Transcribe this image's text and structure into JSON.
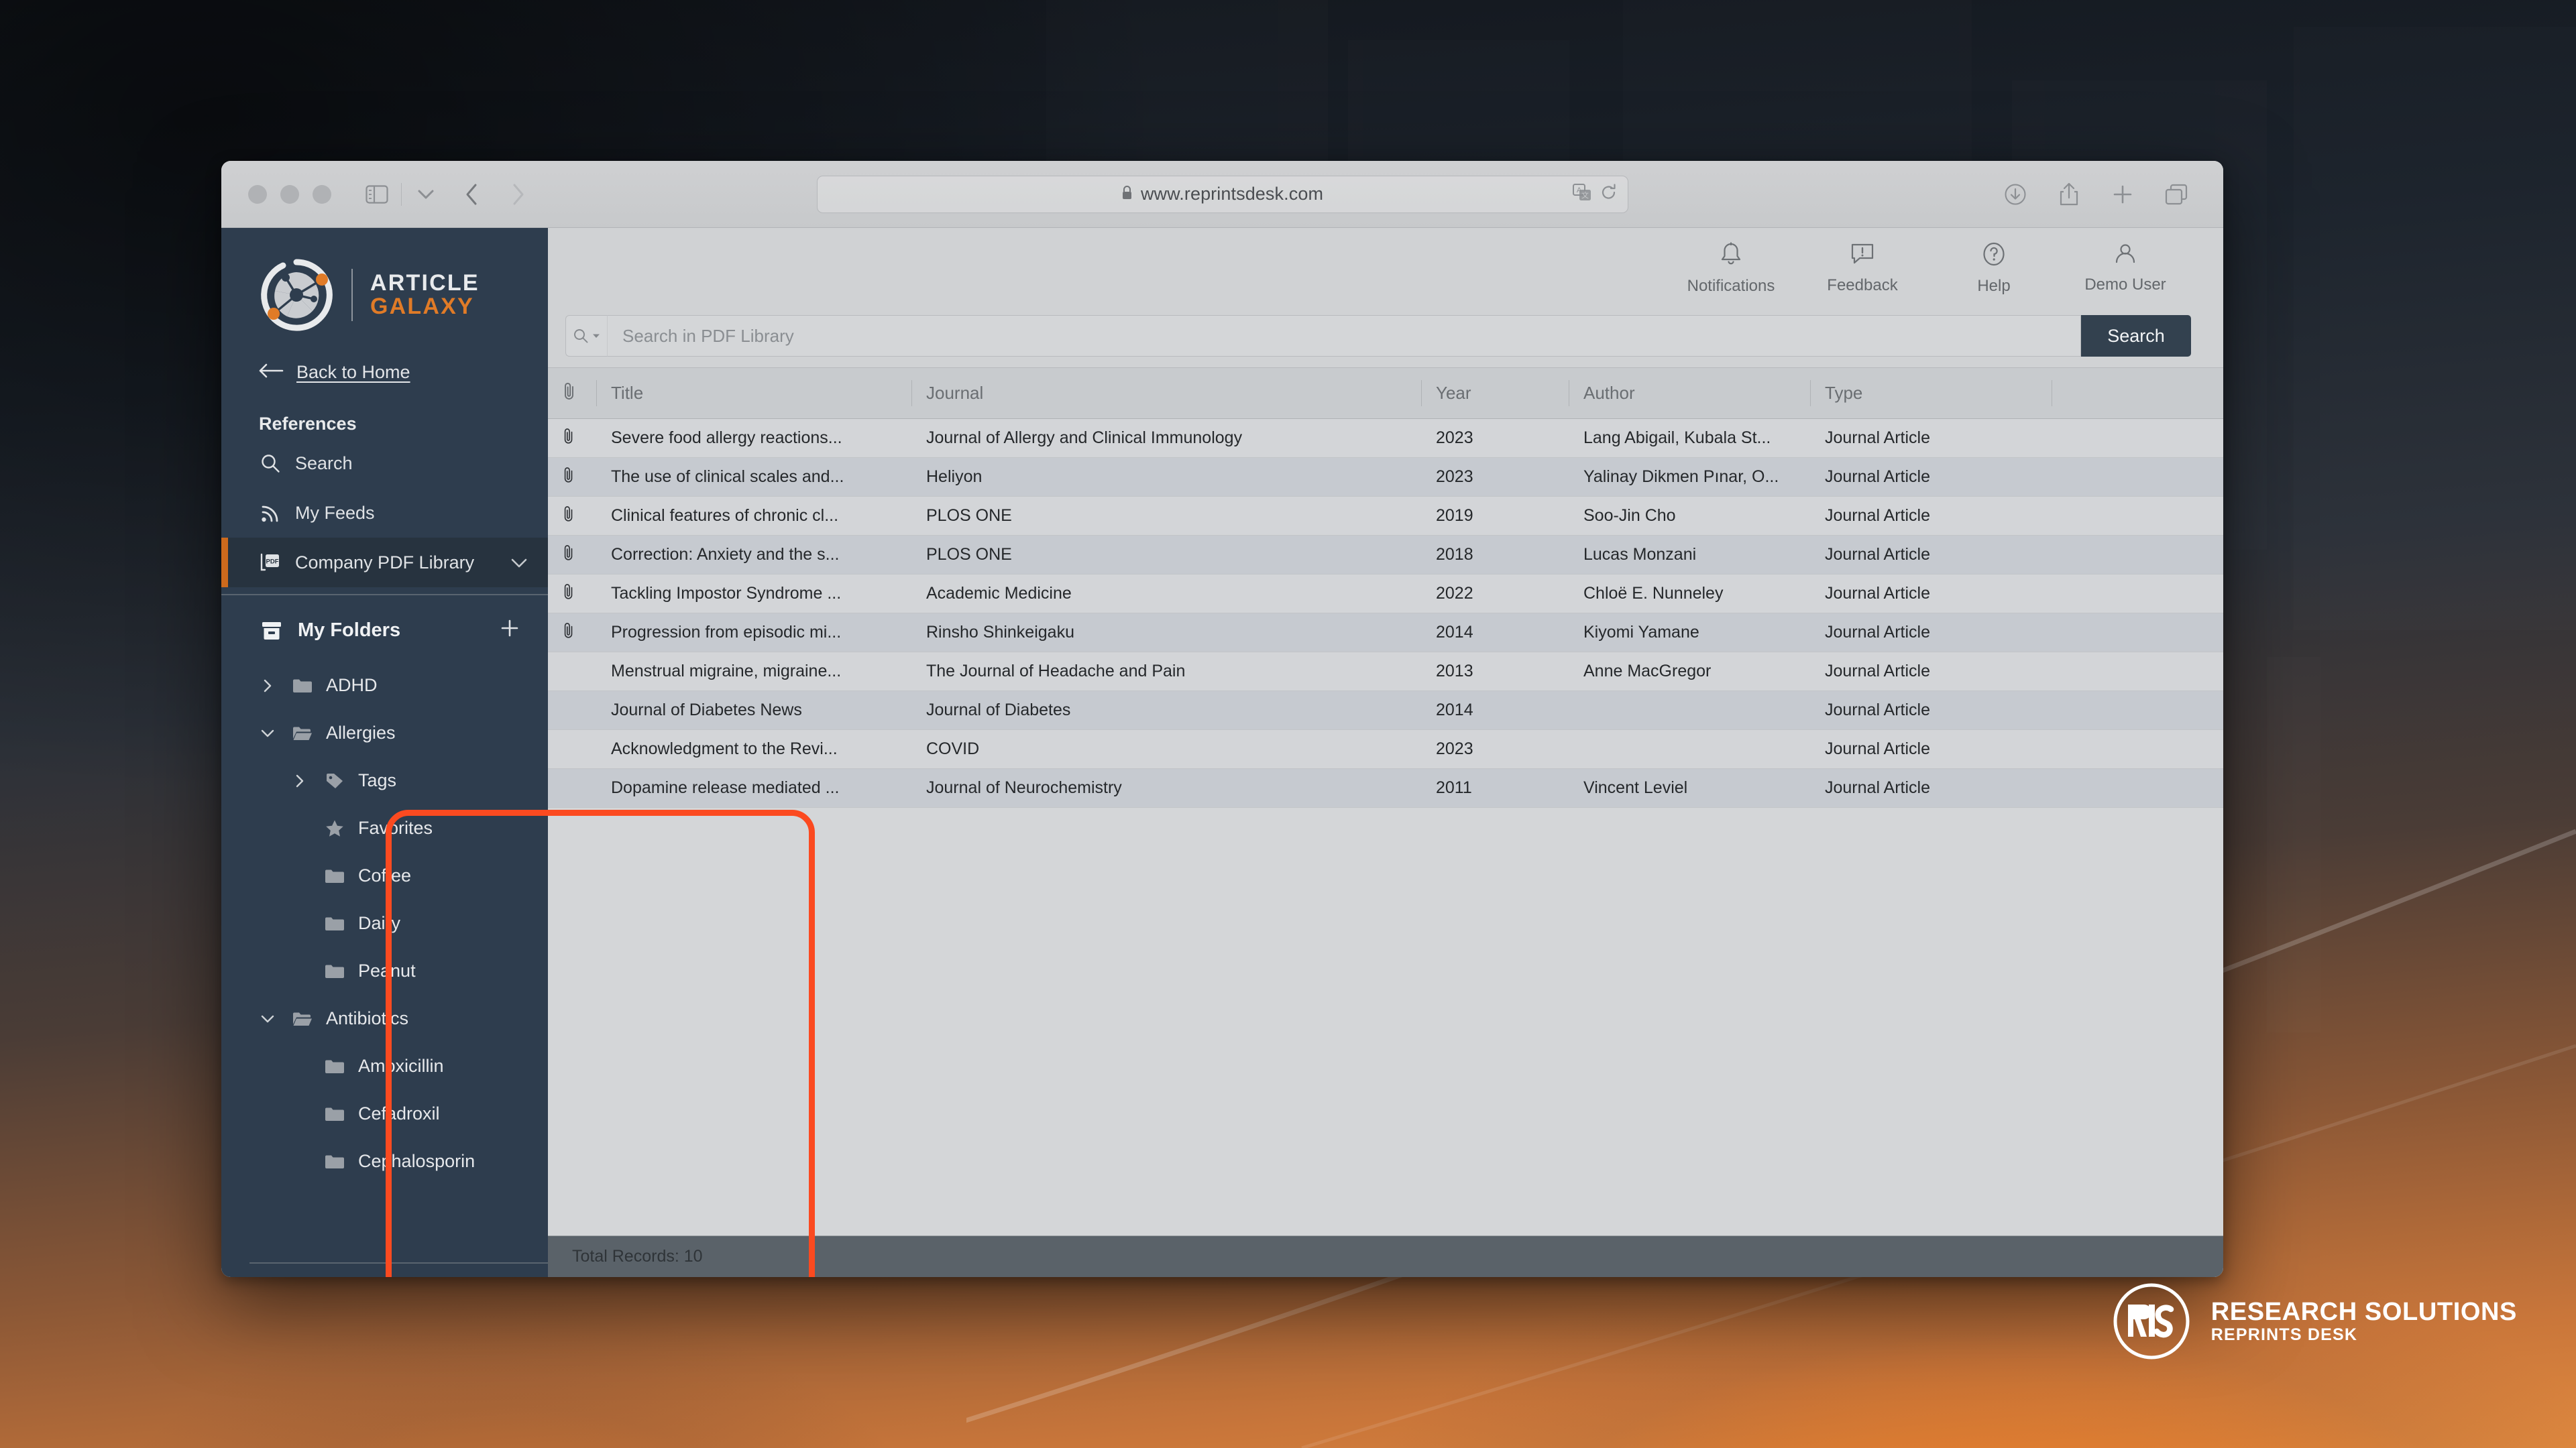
{
  "browser": {
    "url": "www.reprintsdesk.com",
    "lock_icon": "lock-icon",
    "traffic_lights": [
      "close",
      "minimize",
      "maximize"
    ],
    "toolbar_icons": [
      "sidebar-toggle-icon",
      "chevron-down-icon",
      "back-arrow-icon",
      "forward-arrow-icon"
    ],
    "url_right_icons": [
      "translate-icon",
      "reload-icon"
    ],
    "right_icons": [
      "downloads-icon",
      "share-icon",
      "new-tab-icon",
      "tab-overview-icon"
    ]
  },
  "logo": {
    "line1": "ARTICLE",
    "line2": "GALAXY",
    "mark": "article-galaxy-logo"
  },
  "sidebar": {
    "back_home": "Back to Home",
    "back_icon": "arrow-left-icon",
    "section_title": "References",
    "nav": [
      {
        "label": "Search",
        "icon": "search-icon",
        "active": false,
        "chevron": ""
      },
      {
        "label": "My Feeds",
        "icon": "rss-icon",
        "active": false,
        "chevron": ""
      },
      {
        "label": "Company PDF Library",
        "icon": "pdf-icon",
        "active": true,
        "chevron": "chevron-down-icon"
      }
    ],
    "folders": {
      "title": "My Folders",
      "title_icon": "archive-box-icon",
      "add_icon": "plus-icon",
      "tree": [
        {
          "label": "ADHD",
          "icon": "folder-icon",
          "caret": "chevron-right-icon",
          "level": 0
        },
        {
          "label": "Allergies",
          "icon": "folder-open-icon",
          "caret": "chevron-down-icon",
          "level": 0
        },
        {
          "label": "Tags",
          "icon": "tag-icon",
          "caret": "chevron-right-icon",
          "level": 1
        },
        {
          "label": "Favorites",
          "icon": "star-icon",
          "caret": "",
          "level": 1
        },
        {
          "label": "Coffee",
          "icon": "folder-icon",
          "caret": "",
          "level": 1
        },
        {
          "label": "Dairy",
          "icon": "folder-icon",
          "caret": "",
          "level": 1
        },
        {
          "label": "Peanut",
          "icon": "folder-icon",
          "caret": "",
          "level": 1
        },
        {
          "label": "Antibiotics",
          "icon": "folder-open-icon",
          "caret": "chevron-down-icon",
          "level": 0
        },
        {
          "label": "Amoxicillin",
          "icon": "folder-icon",
          "caret": "",
          "level": 1
        },
        {
          "label": "Cefadroxil",
          "icon": "folder-icon",
          "caret": "",
          "level": 1
        },
        {
          "label": "Cephalosporin",
          "icon": "folder-icon",
          "caret": "",
          "level": 1
        }
      ]
    }
  },
  "topbar": {
    "actions": [
      {
        "label": "Notifications",
        "icon": "bell-icon"
      },
      {
        "label": "Feedback",
        "icon": "feedback-chat-icon"
      },
      {
        "label": "Help",
        "icon": "question-circle-icon"
      },
      {
        "label": "Demo User",
        "icon": "user-icon"
      }
    ]
  },
  "search": {
    "placeholder": "Search in PDF Library",
    "value": "",
    "mode_icon": "search-icon",
    "mode_caret": "caret-down-icon",
    "button_label": "Search"
  },
  "table": {
    "columns": [
      "",
      "Title",
      "Journal",
      "Year",
      "Author",
      "Type",
      ""
    ],
    "clip_icon": "paperclip-icon",
    "rows": [
      {
        "clip": true,
        "title": "Severe food allergy reactions...",
        "journal": "Journal of Allergy and Clinical Immunology",
        "year": "2023",
        "author": "Lang Abigail, Kubala St...",
        "type": "Journal Article"
      },
      {
        "clip": true,
        "title": "The use of clinical scales and...",
        "journal": "Heliyon",
        "year": "2023",
        "author": "Yalinay Dikmen Pınar, O...",
        "type": "Journal Article"
      },
      {
        "clip": true,
        "title": "Clinical features of chronic cl...",
        "journal": "PLOS ONE",
        "year": "2019",
        "author": "Soo-Jin Cho",
        "type": "Journal Article"
      },
      {
        "clip": true,
        "title": "Correction: Anxiety and the s...",
        "journal": "PLOS ONE",
        "year": "2018",
        "author": "Lucas Monzani",
        "type": "Journal Article"
      },
      {
        "clip": true,
        "title": "Tackling Impostor Syndrome ...",
        "journal": "Academic Medicine",
        "year": "2022",
        "author": "Chloë E. Nunneley",
        "type": "Journal Article"
      },
      {
        "clip": true,
        "title": "Progression from episodic mi...",
        "journal": "Rinsho Shinkeigaku",
        "year": "2014",
        "author": "Kiyomi Yamane",
        "type": "Journal Article"
      },
      {
        "clip": false,
        "title": "Menstrual migraine, migraine...",
        "journal": "The Journal of Headache and Pain",
        "year": "2013",
        "author": "Anne MacGregor",
        "type": "Journal Article"
      },
      {
        "clip": false,
        "title": "Journal of Diabetes News",
        "journal": "Journal of Diabetes",
        "year": "2014",
        "author": "",
        "type": "Journal Article"
      },
      {
        "clip": false,
        "title": "Acknowledgment to the Revi...",
        "journal": "COVID",
        "year": "2023",
        "author": "",
        "type": "Journal Article"
      },
      {
        "clip": false,
        "title": "Dopamine release mediated ...",
        "journal": "Journal of Neurochemistry",
        "year": "2011",
        "author": "Vincent Leviel",
        "type": "Journal Article"
      }
    ],
    "footer": "Total Records: 10"
  },
  "watermark": {
    "mark": "rs-circle-logo",
    "main": "RESEARCH SOLUTIONS",
    "sub": "REPRINTS DESK"
  },
  "annotation": {
    "shape": "rounded-rectangle-highlight",
    "color": "#fb4a20"
  },
  "colors": {
    "sidebar_bg": "#2e3d4e",
    "sidebar_active_bg": "#27333f",
    "accent_orange": "#e07b27",
    "active_bar": "#cd6a1d",
    "search_button": "#33414f",
    "annotation": "#fb4a20",
    "table_row_odd": "#d3d5d8",
    "table_row_even": "#c6cad0"
  }
}
